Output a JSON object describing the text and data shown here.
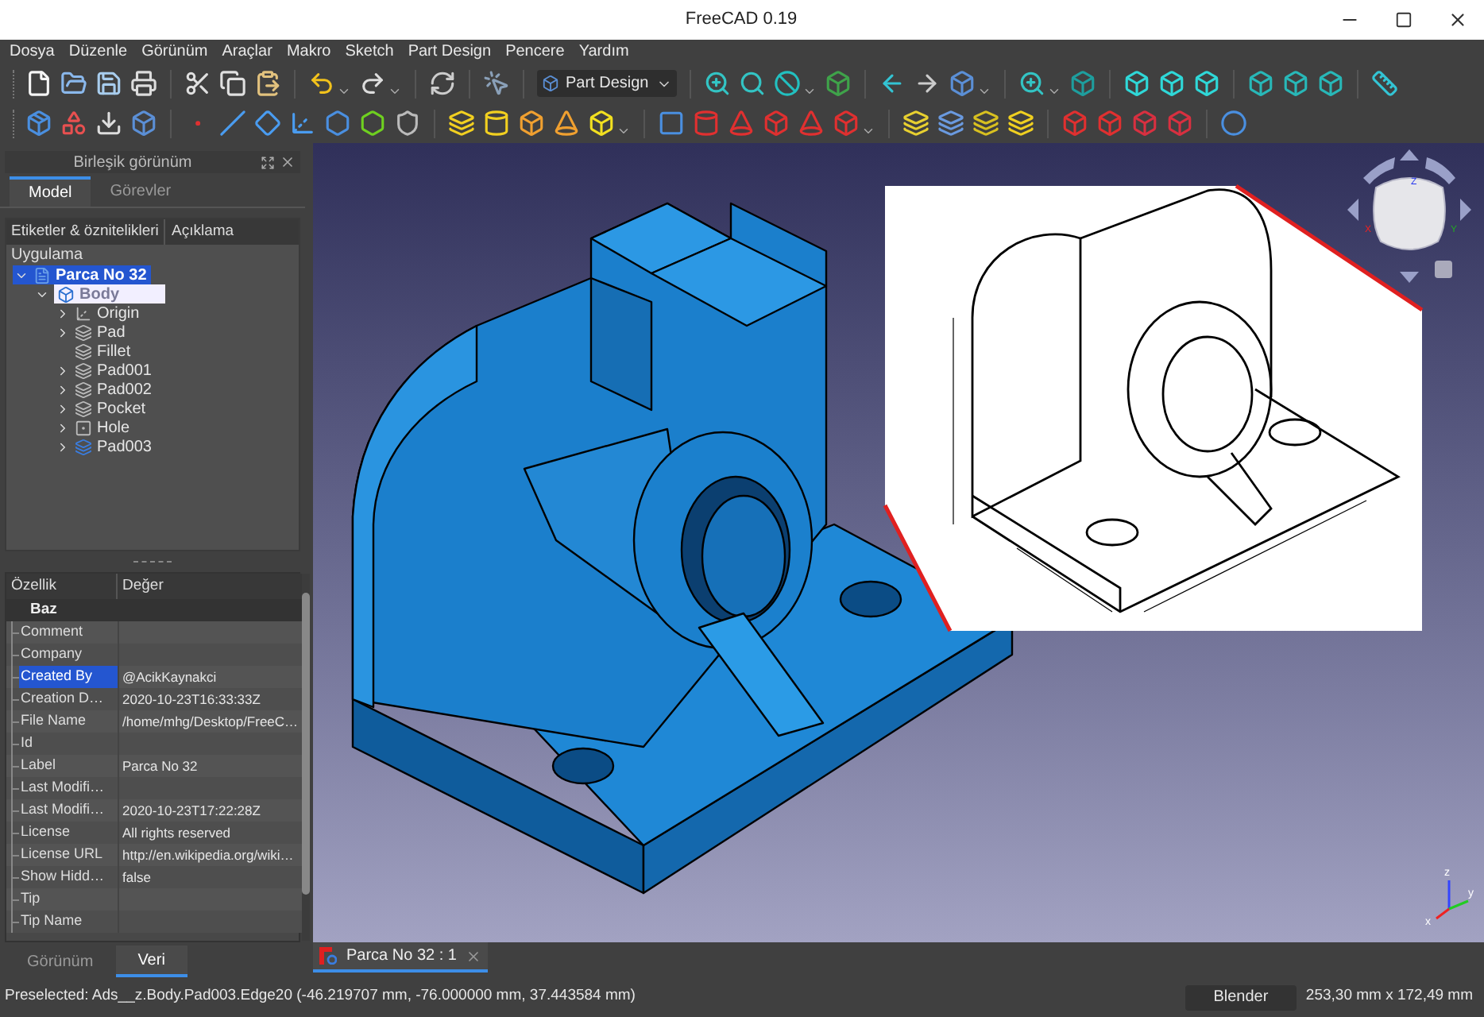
{
  "window": {
    "title": "FreeCAD 0.19"
  },
  "menu": [
    "Dosya",
    "Düzenle",
    "Görünüm",
    "Araçlar",
    "Makro",
    "Sketch",
    "Part Design",
    "Pencere",
    "Yardım"
  ],
  "toolbar": {
    "workbench": "Part Design"
  },
  "combo_view": {
    "title": "Birleşik görünüm",
    "tabs": [
      {
        "label": "Model",
        "selected": true
      },
      {
        "label": "Görevler",
        "selected": false
      }
    ],
    "tree": {
      "columns": [
        "Etiketler & öznitelikleri",
        "Açıklama"
      ],
      "root": "Uygulama",
      "items": [
        {
          "label": "Parca No 32",
          "kind": "document",
          "selected": true,
          "expanded": true,
          "children": [
            {
              "label": "Body",
              "kind": "body",
              "selected": false,
              "editing": true,
              "expanded": true,
              "children": [
                {
                  "label": "Origin",
                  "kind": "origin",
                  "selected": false,
                  "expanded": false
                },
                {
                  "label": "Pad",
                  "kind": "feature",
                  "selected": false,
                  "expanded": false
                },
                {
                  "label": "Fillet",
                  "kind": "feature",
                  "selected": false
                },
                {
                  "label": "Pad001",
                  "kind": "feature",
                  "selected": false,
                  "expanded": false
                },
                {
                  "label": "Pad002",
                  "kind": "feature",
                  "selected": false,
                  "expanded": false
                },
                {
                  "label": "Pocket",
                  "kind": "feature",
                  "selected": false,
                  "expanded": false
                },
                {
                  "label": "Hole",
                  "kind": "hole",
                  "selected": false,
                  "expanded": false
                },
                {
                  "label": "Pad003",
                  "kind": "tip",
                  "selected": false,
                  "expanded": false
                }
              ]
            }
          ]
        }
      ]
    }
  },
  "property_view": {
    "columns": [
      "Özellik",
      "Değer"
    ],
    "group": "Baz",
    "rows": [
      {
        "name": "Comment",
        "selected": false
      },
      {
        "name": "Company",
        "selected": false
      },
      {
        "name": "Created By",
        "value": "@AcikKaynakci",
        "selected": true
      },
      {
        "name": "Creation D…",
        "value": "2020-10-23T16:33:33Z",
        "selected": false
      },
      {
        "name": "File Name",
        "value": "/home/mhg/Desktop/FreeC…",
        "selected": false
      },
      {
        "name": "Id",
        "selected": false
      },
      {
        "name": "Label",
        "value": "Parca No 32",
        "selected": false
      },
      {
        "name": "Last Modifi…",
        "selected": false
      },
      {
        "name": "Last Modifi…",
        "value": "2020-10-23T17:22:28Z",
        "selected": false
      },
      {
        "name": "License",
        "value": "All rights reserved",
        "selected": false
      },
      {
        "name": "License URL",
        "value": "http://en.wikipedia.org/wiki…",
        "selected": false
      },
      {
        "name": "Show Hidd…",
        "value": "false",
        "selected": false
      },
      {
        "name": "Tip",
        "selected": false
      },
      {
        "name": "Tip Name",
        "selected": false
      }
    ]
  },
  "panel_tabs": [
    {
      "label": "Görünüm",
      "selected": false
    },
    {
      "label": "Veri",
      "selected": true
    }
  ],
  "viewport": {
    "nav_cube": {
      "axes": [
        "Z",
        "X",
        "Y"
      ]
    },
    "axis_indicator": {
      "axes": [
        "z",
        "y",
        "x"
      ]
    }
  },
  "document_tabs": [
    {
      "label": "Parca No 32 : 1",
      "selected": true
    }
  ],
  "status_bar": {
    "message": "Preselected: Ads__z.Body.Pad003.Edge20 (-46.219707 mm, -76.000000 mm, 37.443584 mm)",
    "navigation": "Blender",
    "dimensions": "253,30 mm x 172,49 mm"
  }
}
